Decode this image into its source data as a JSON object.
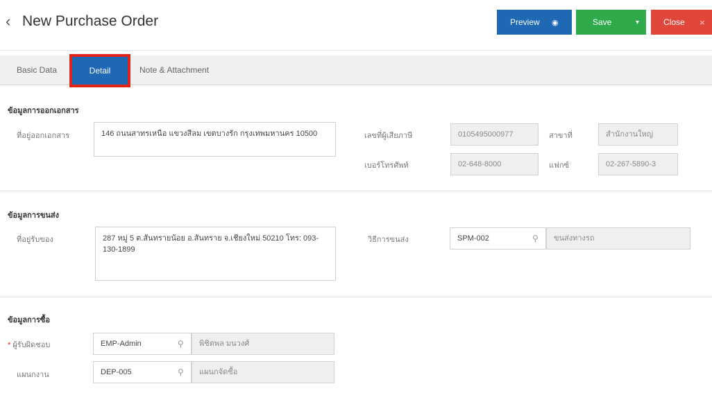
{
  "header": {
    "back_icon": "‹",
    "title": "New Purchase Order",
    "preview_label": "Preview",
    "preview_icon": "◉",
    "save_label": "Save",
    "save_icon": "▾",
    "close_label": "Close",
    "close_icon": "×"
  },
  "tabs": {
    "basic": "Basic Data",
    "detail": "Detail",
    "note": "Note & Attachment"
  },
  "doc_section": {
    "title": "ข้อมูลการออกเอกสาร",
    "address_label": "ที่อยู่ออกเอกสาร",
    "address_value": "146 ถนนสาทรเหนือ แขวงสีลม เขตบางรัก กรุงเทพมหานคร 10500",
    "tax_label": "เลขที่ผู้เสียภาษี",
    "tax_value": "0105495000977",
    "branch_label": "สาขาที่",
    "branch_value": "สำนักงานใหญ่",
    "phone_label": "เบอร์โทรศัพท์",
    "phone_value": "02-648-8000",
    "fax_label": "แฟกซ์",
    "fax_value": "02-267-5890-3"
  },
  "ship_section": {
    "title": "ข้อมูลการขนส่ง",
    "receive_label": "ที่อยู่รับของ",
    "receive_value": "287 หมู่ 5 ต.สันทรายน้อย อ.สันทราย จ.เชียงใหม่ 50210 โทร: 093-130-1899",
    "method_label": "วิธีการขนส่ง",
    "method_code": "SPM-002",
    "method_name": "ขนส่งทางรถ"
  },
  "buy_section": {
    "title": "ข้อมูลการซื้อ",
    "required_mark": "*",
    "owner_label": "ผู้รับผิดชอบ",
    "owner_code": "EMP-Admin",
    "owner_name": "พิชิตพล มนวงศ์",
    "dept_label": "แผนกงาน",
    "dept_code": "DEP-005",
    "dept_name": "แผนกจัดซื้อ"
  },
  "icons": {
    "search": "⚲"
  }
}
